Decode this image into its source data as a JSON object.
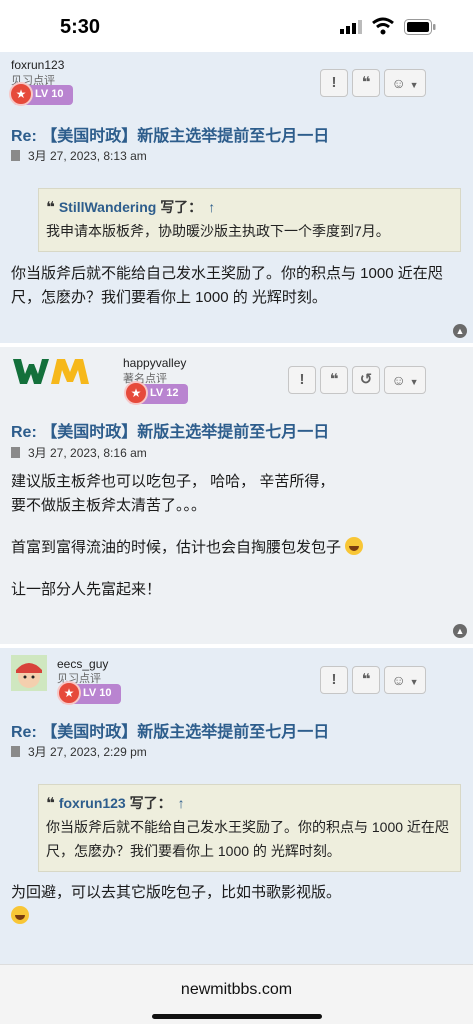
{
  "status_bar": {
    "time": "5:30"
  },
  "posts": [
    {
      "username": "foxrun123",
      "rank": "见习点评",
      "level": "LV 10",
      "title": "Re: 【美国时政】新版主选举提前至七月一日",
      "date": "3月 27, 2023, 8:13 am",
      "quote": {
        "author": "StillWandering",
        "wrote": "写了：",
        "arrow": "↑",
        "text": "我申请本版板斧，协助暖沙版主执政下一个季度到7月。"
      },
      "body_lines": [
        "你当版斧后就不能给自己发水王奖励了。你的积点与 1000 近在咫尺，怎麽办？我们要看你上 1000 的 光辉时刻。"
      ]
    },
    {
      "username": "happyvalley",
      "rank": "著名点评",
      "level": "LV 12",
      "title": "Re: 【美国时政】新版主选举提前至七月一日",
      "date": "3月 27, 2023, 8:16 am",
      "body_lines": [
        "建议版主板斧也可以吃包子， 哈哈， 辛苦所得，",
        "要不做版主板斧太清苦了。。。",
        "首富到富得流油的时候，估计也会自掏腰包发包子",
        "让一部分人先富起来！"
      ]
    },
    {
      "username": "eecs_guy",
      "rank": "见习点评",
      "level": "LV 10",
      "title": "Re: 【美国时政】新版主选举提前至七月一日",
      "date": "3月 27, 2023, 2:29 pm",
      "quote": {
        "author": "foxrun123",
        "wrote": "写了：",
        "arrow": "↑",
        "text": "你当版斧后就不能给自己发水王奖励了。你的积点与 1000 近在咫尺，怎麽办？我们要看你上 1000 的 光辉时刻。"
      },
      "body_lines": [
        "为回避，可以去其它版吃包子，比如书歌影视版。"
      ]
    }
  ],
  "icons": [
    "report-icon",
    "quote-icon",
    "history-icon",
    "reaction-icon",
    "chevron-down-icon",
    "back-to-top-icon"
  ],
  "footer": {
    "url": "newmitbbs.com"
  },
  "colors": {
    "post_bg": "#e6edf5",
    "title": "#2d5d8c",
    "badge": "#b984d0",
    "quote_bg": "#eeeedd"
  }
}
